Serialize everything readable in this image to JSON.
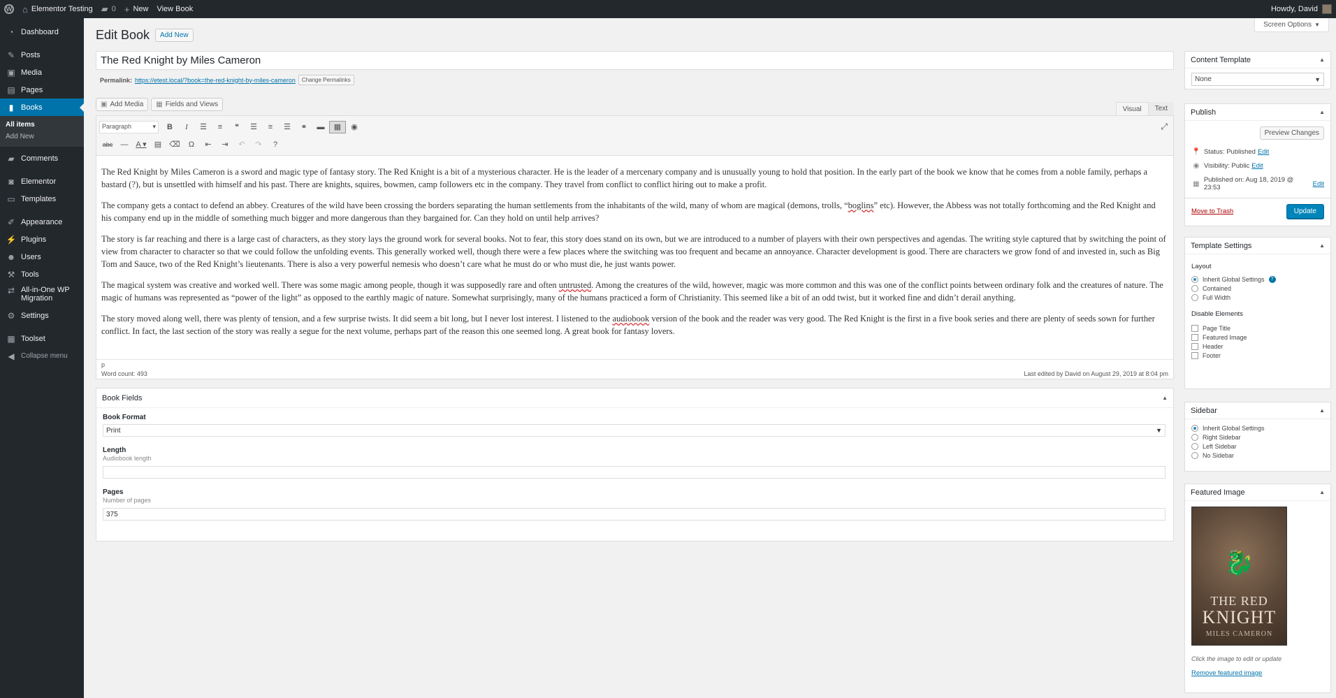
{
  "adminbar": {
    "site_name": "Elementor Testing",
    "comments_count": "0",
    "new_label": "New",
    "view_label": "View Book",
    "howdy": "Howdy, David"
  },
  "sidebar": {
    "items": [
      {
        "label": "Dashboard",
        "icon": "dashboard-icon"
      },
      {
        "label": "Posts",
        "icon": "pin-icon"
      },
      {
        "label": "Media",
        "icon": "media-icon"
      },
      {
        "label": "Pages",
        "icon": "pages-icon"
      },
      {
        "label": "Books",
        "icon": "book-icon"
      },
      {
        "label": "Comments",
        "icon": "comment-icon"
      },
      {
        "label": "Elementor",
        "icon": "elementor-icon"
      },
      {
        "label": "Templates",
        "icon": "folder-icon"
      },
      {
        "label": "Appearance",
        "icon": "brush-icon"
      },
      {
        "label": "Plugins",
        "icon": "plug-icon"
      },
      {
        "label": "Users",
        "icon": "users-icon"
      },
      {
        "label": "Tools",
        "icon": "wrench-icon"
      },
      {
        "label": "All-in-One WP Migration",
        "icon": "migration-icon"
      },
      {
        "label": "Settings",
        "icon": "settings-icon"
      },
      {
        "label": "Toolset",
        "icon": "toolset-icon"
      },
      {
        "label": "Collapse menu",
        "icon": "collapse-icon"
      }
    ],
    "submenu": [
      "All items",
      "Add New"
    ]
  },
  "screen_options": "Screen Options",
  "page": {
    "title": "Edit Book",
    "add_new": "Add New",
    "post_title": "The Red Knight by Miles Cameron",
    "permalink_label": "Permalink:",
    "permalink_url": "https://etest.local/?book=the-red-knight-by-miles-cameron",
    "change_permalinks": "Change Permalinks",
    "add_media": "Add Media",
    "fields_views": "Fields and Views",
    "tab_visual": "Visual",
    "tab_text": "Text",
    "format_select": "Paragraph"
  },
  "content": {
    "p1": "The Red Knight by Miles Cameron is a sword and magic type of fantasy story. The Red Knight is a bit of a mysterious character. He is the leader of a mercenary company and is unusually young to hold that position. In the early part of the book we know that he comes from a noble family, perhaps a bastard (?), but is unsettled with himself and his past. There are knights, squires, bowmen, camp followers etc in the company. They travel from conflict to conflict hiring out to make a profit.",
    "p2a": "The company gets a contact to defend an abbey. Creatures of the wild have been crossing the borders separating the human settlements from the inhabitants of the wild, many of whom are magical (demons, trolls, “",
    "p2b": "boglins",
    "p2c": "” etc).  However, the Abbess was not totally forthcoming and the Red Knight and his company end up in the middle of something much bigger and more dangerous than they bargained for.  Can they hold on until help arrives?",
    "p3": "The story is far reaching and there is a large cast of characters, as they story lays the ground work for several books.  Not to fear, this story does stand on its own, but we are introduced to a number of players with their own perspectives and agendas.  The writing style captured that by switching the point of view from character to character so that we could follow the unfolding events.  This generally worked well, though there were a few places where the switching was too frequent and became an annoyance.  Character development is good.  There are characters we grow fond of and invested in, such as Big Tom and Sauce, two of the Red Knight’s lieutenants.  There is also a very powerful nemesis who doesn’t care what he must do or who must die, he just wants power.",
    "p4a": "The magical system was creative and worked well.  There was some magic among people, though it was supposedly rare and often ",
    "p4b": "untrusted",
    "p4c": ".  Among the creatures of the wild, however, magic was more common and this was one of the conflict points between ordinary folk and the creatures of nature.  The magic of humans was represented as “power of the light” as opposed to the earthly magic of nature.  Somewhat surprisingly, many of the humans practiced a form of Christianity.  This seemed like a bit of an odd twist, but it worked fine and didn’t derail anything.",
    "p5a": "The story moved along well, there was plenty of tension, and a few surprise twists.  It did seem a bit long, but I never lost interest.  I listened to the ",
    "p5b": "audiobook",
    "p5c": " version of the book and the reader was very good.  The Red Knight is the first in a five book series and there are plenty of seeds sown for further conflict. In fact, the last section of the story was really a segue for the next volume, perhaps part of the reason this one seemed long.  A great book for fantasy lovers."
  },
  "status_bar": {
    "path": "p",
    "word_count": "Word count: 493",
    "last_edited": "Last edited by David on August 29, 2019 at 8:04 pm"
  },
  "book_fields": {
    "title": "Book Fields",
    "format_label": "Book Format",
    "format_value": "Print",
    "length_label": "Length",
    "length_desc": "Audiobook length",
    "length_value": "",
    "pages_label": "Pages",
    "pages_desc": "Number of pages",
    "pages_value": "375"
  },
  "content_template": {
    "title": "Content Template",
    "value": "None"
  },
  "publish": {
    "title": "Publish",
    "preview": "Preview Changes",
    "status_label": "Status: Published",
    "visibility_label": "Visibility: Public",
    "published_on": "Published on: Aug 18, 2019 @ 23:53",
    "edit": "Edit",
    "trash": "Move to Trash",
    "update": "Update"
  },
  "template_settings": {
    "title": "Template Settings",
    "layout_label": "Layout",
    "layouts": [
      "Inherit Global Settings",
      "Contained",
      "Full Width"
    ],
    "disable_label": "Disable Elements",
    "elements": [
      "Page Title",
      "Featured Image",
      "Header",
      "Footer"
    ]
  },
  "sidebar_box": {
    "title": "Sidebar",
    "options": [
      "Inherit Global Settings",
      "Right Sidebar",
      "Left Sidebar",
      "No Sidebar"
    ]
  },
  "featured_image": {
    "title": "Featured Image",
    "cover_title_line1": "THE RED",
    "cover_title_line2": "KNIGHT",
    "cover_author": "MILES CAMERON",
    "note": "Click the image to edit or update",
    "remove": "Remove featured image"
  },
  "colors": {
    "accent": "#0073aa",
    "primary_button": "#0085ba",
    "admin_dark": "#23282d"
  }
}
